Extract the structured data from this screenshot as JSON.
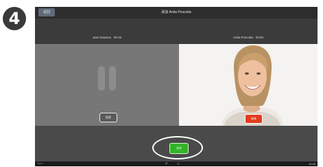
{
  "step_number": "4",
  "header": {
    "back_label": "返回",
    "title": "添加 Anita Poscotta"
  },
  "participants": {
    "left": {
      "name": "Jane Dawson",
      "duration": "00:45",
      "button_label": "恢复"
    },
    "right": {
      "name": "Anita Poscotta",
      "duration": "00:00",
      "button_label": "结束"
    }
  },
  "merge_label": "合并",
  "navbar": {
    "left": "Cisco",
    "time": "10:56"
  },
  "colors": {
    "end_button": "#e23c1e",
    "merge_button": "#31b428"
  }
}
